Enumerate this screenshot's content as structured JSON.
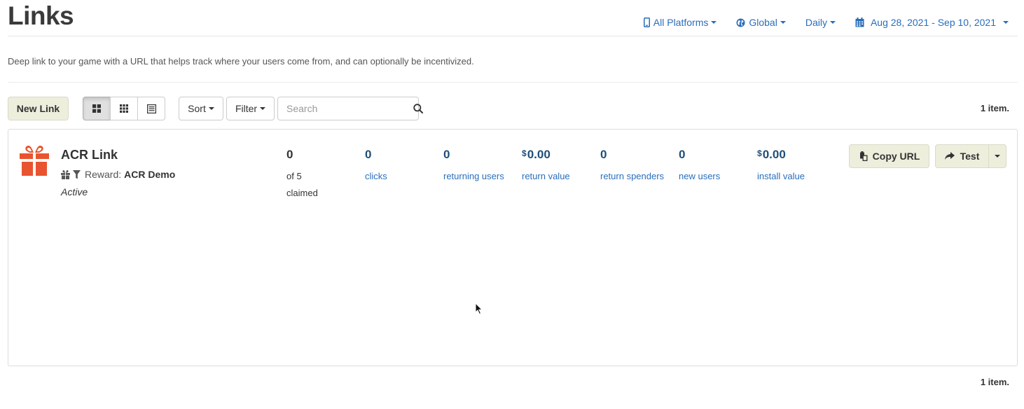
{
  "page": {
    "title": "Links",
    "description": "Deep link to your game with a URL that helps track where your users come from, and can optionally be incentivized."
  },
  "header": {
    "platforms": {
      "label": "All Platforms",
      "icon": "mobile-phone-icon"
    },
    "region": {
      "label": "Global",
      "icon": "globe-icon"
    },
    "interval": {
      "label": "Daily"
    },
    "date_range": {
      "label": "Aug 28, 2021 - Sep 10, 2021",
      "icon": "calendar-icon"
    }
  },
  "toolbar": {
    "new_link_label": "New Link",
    "view_modes": [
      "large-grid-view-icon",
      "small-grid-view-icon",
      "list-view-icon"
    ],
    "active_view": "large-grid-view-icon",
    "sort_label": "Sort",
    "filter_label": "Filter",
    "search_placeholder": "Search",
    "search_value": ""
  },
  "item_count_label": "1 item.",
  "links": [
    {
      "name": "ACR Link",
      "icon": "gift-icon",
      "reward_label": "Reward:",
      "reward_value": "ACR Demo",
      "status": "Active",
      "stats": {
        "claimed": {
          "value": "0",
          "label_line1": "of 5",
          "label_line2": "claimed"
        },
        "clicks": {
          "value": "0",
          "label": "clicks"
        },
        "returning_users": {
          "value": "0",
          "label": "returning users"
        },
        "return_value": {
          "currency": "$",
          "value": "0.00",
          "label": "return value"
        },
        "return_spenders": {
          "value": "0",
          "label": "return spenders"
        },
        "new_users": {
          "value": "0",
          "label": "new users"
        },
        "install_value": {
          "currency": "$",
          "value": "0.00",
          "label": "install value"
        }
      },
      "actions": {
        "copy_url_label": "Copy URL",
        "test_label": "Test"
      }
    }
  ],
  "colors": {
    "accent_link": "#2a6ebb",
    "stat_value": "#1f4e79",
    "gift_icon": "#e8542f",
    "action_button_bg": "#eeeedd"
  }
}
